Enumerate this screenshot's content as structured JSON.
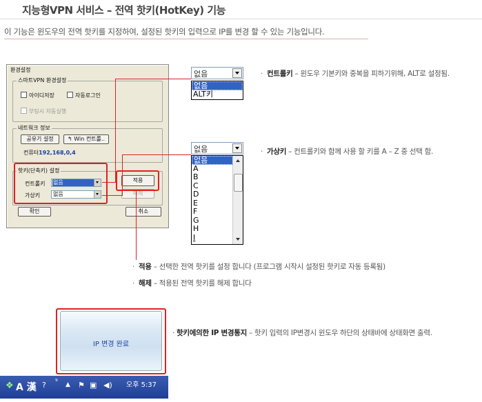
{
  "page": {
    "title": "지능형VPN 서비스 – 전역 핫키(HotKey) 기능",
    "intro": "이 기능은  윈도우의 전역 핫키를 지정하여, 설정된 핫키의 입력으로 IP를 변경 할 수 있는 기능입니다."
  },
  "dialog": {
    "title": "환경설정",
    "smart_group": "스마트VPN 환경설정",
    "save_id": "아이디저장",
    "auto_login": "자동로그인",
    "boot_run": "부팅시 자동실행",
    "network_group": "네트워크 정보",
    "share_btn": "공유기 설정",
    "win_ctrl_btn": "Win 컨트롤..",
    "computer_label": "컨퓨터",
    "computer_ip": "192,168,0,4",
    "hotkey_group": "핫키(단축키) 설정",
    "control_key_label": "컨트롤키",
    "control_key_value": "없음",
    "virtual_key_label": "가상키",
    "virtual_key_value": "없음",
    "apply_btn": "적용",
    "release_btn": "해제",
    "ok_btn": "확인",
    "cancel_btn": "취소"
  },
  "control_dropdown": {
    "selected": "없음",
    "options": [
      "없음",
      "ALT키"
    ]
  },
  "virtual_dropdown": {
    "selected": "없음",
    "options": [
      "없음",
      "A",
      "B",
      "C",
      "D",
      "E",
      "F",
      "G",
      "H",
      "I"
    ]
  },
  "notes": {
    "control_key_name": "컨트롤키",
    "control_key_desc": " – 윈도우 기본키와 중복을 피하기위해, ALT로  설정됨.",
    "virtual_key_name": "가상키",
    "virtual_key_desc": " – 컨트롤키와 함께 사용 할 키를 A – Z 중   선택 함.",
    "apply_name": "적용",
    "apply_desc": " – 선택한 전역 핫키를 설정 합니다 (프로그램 시작시 설정된 핫키로 자동 등록됨)",
    "release_name": "해제",
    "release_desc": " – 적용된 전역 핫키를 해제 합니다",
    "notify_name": "핫키에의한 IP 변경통지",
    "notify_desc": " – 핫키 입력의 IP변경시  윈도우 하단의 상태바에 상태화면 출력."
  },
  "notify_popup": {
    "message": "IP 변경 완료"
  },
  "taskbar": {
    "ime": "A 漢",
    "time": "오후 5:37"
  },
  "colors": {
    "highlight": "#e02020",
    "selection": "#3163c5"
  }
}
